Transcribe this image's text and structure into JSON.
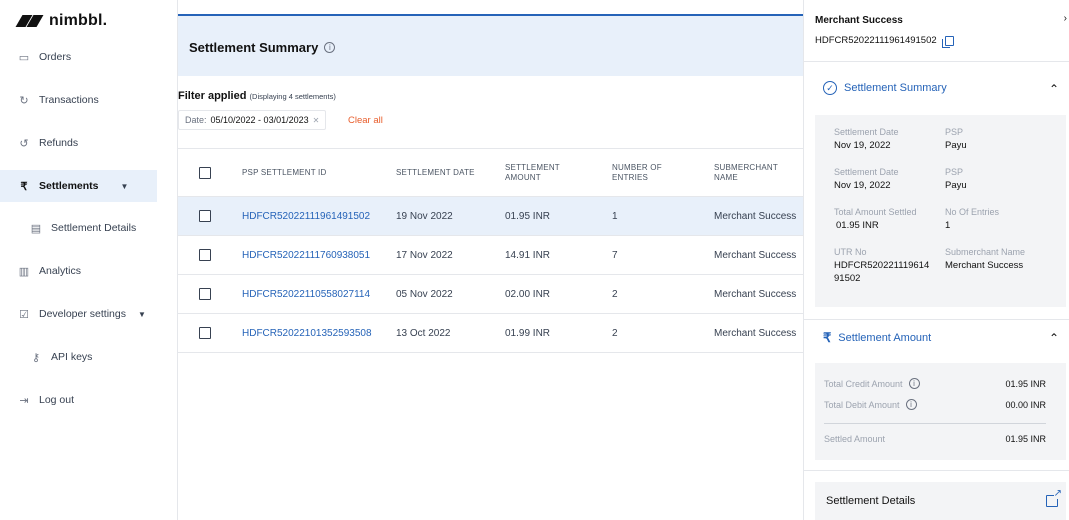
{
  "brand": {
    "name": "nimbbl."
  },
  "sidebar": {
    "items": [
      {
        "label": "Orders",
        "icon": "orders-icon"
      },
      {
        "label": "Transactions",
        "icon": "transactions-icon"
      },
      {
        "label": "Refunds",
        "icon": "refunds-icon"
      },
      {
        "label": "Settlements",
        "icon": "rupee-icon",
        "active": true
      },
      {
        "label": "Settlement Details",
        "icon": "document-icon"
      },
      {
        "label": "Analytics",
        "icon": "analytics-icon"
      },
      {
        "label": "Developer settings",
        "icon": "developer-icon"
      },
      {
        "label": "API keys",
        "icon": "key-icon"
      },
      {
        "label": "Log out",
        "icon": "logout-icon"
      }
    ]
  },
  "main": {
    "title": "Settlement Summary",
    "filter": {
      "title": "Filter applied",
      "count_text": "(Displaying 4 settlements)",
      "chip_label": "Date:",
      "chip_value": "05/10/2022 - 03/01/2023",
      "clear_label": "Clear all"
    },
    "table": {
      "columns": [
        "PSP SETTLEMENT ID",
        "SETTLEMENT DATE",
        "SETTLEMENT AMOUNT",
        "NUMBER OF ENTRIES",
        "SUBMERCHANT NAME"
      ],
      "rows": [
        {
          "id": "HDFCR52022111961491502",
          "date": "19 Nov 2022",
          "amount": "01.95 INR",
          "entries": "1",
          "submerchant": "Merchant Success"
        },
        {
          "id": "HDFCR52022111760938051",
          "date": "17 Nov 2022",
          "amount": "14.91 INR",
          "entries": "7",
          "submerchant": "Merchant Success"
        },
        {
          "id": "HDFCR52022110558027114",
          "date": "05 Nov 2022",
          "amount": "02.00 INR",
          "entries": "2",
          "submerchant": "Merchant Success"
        },
        {
          "id": "HDFCR52022101352593508",
          "date": "13 Oct 2022",
          "amount": "01.99 INR",
          "entries": "2",
          "submerchant": "Merchant Success"
        }
      ]
    }
  },
  "panel": {
    "title": "Merchant Success",
    "id": "HDFCR52022111961491502",
    "summary": {
      "heading": "Settlement Summary",
      "fields": [
        {
          "label": "Settlement Date",
          "value": "Nov 19, 2022"
        },
        {
          "label": "PSP",
          "value": "Payu"
        },
        {
          "label": "Settlement Date",
          "value": "Nov 19, 2022"
        },
        {
          "label": "PSP",
          "value": "Payu"
        },
        {
          "label": "Total Amount Settled",
          "value": "01.95 INR"
        },
        {
          "label": "No Of Entries",
          "value": "1"
        },
        {
          "label": "UTR No",
          "value": "HDFCR520221119614\n91502"
        },
        {
          "label": "Submerchant Name",
          "value": "Merchant Success"
        }
      ]
    },
    "amount": {
      "heading": "Settlement Amount",
      "credit_label": "Total Credit Amount",
      "credit_value": "01.95 INR",
      "debit_label": "Total Debit Amount",
      "debit_value": "00.00 INR",
      "settled_label": "Settled Amount",
      "settled_value": "01.95 INR"
    },
    "details_label": "Settlement Details"
  },
  "colors": {
    "accent": "#2563b8",
    "highlight": "#e8f0fa",
    "clear": "#e85d2b"
  }
}
